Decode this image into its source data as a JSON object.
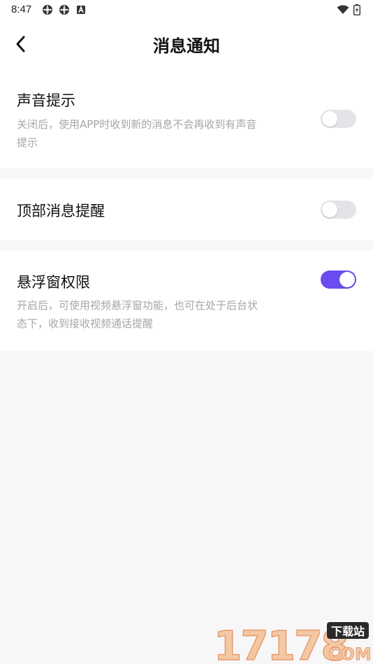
{
  "status_bar": {
    "time": "8:47",
    "left_icons": [
      "gear-notification-icon",
      "gear-notification-icon",
      "a-letter-icon"
    ],
    "right_icons": [
      "wifi-icon",
      "battery-icon"
    ]
  },
  "header": {
    "title": "消息通知",
    "back_icon": "chevron-left-icon"
  },
  "settings": [
    {
      "title": "声音提示",
      "description_line1": "关闭后，使用APP时收到新的消息不会再收到有声音",
      "description_line2": "提示",
      "enabled": false
    },
    {
      "title": "顶部消息提醒",
      "enabled": false
    },
    {
      "title": "悬浮窗权限",
      "description_line1": "开启后，可使用视频悬浮窗功能，也可在处于后台状",
      "description_line2": "态下，收到接收视频通话提醒",
      "enabled": true
    }
  ],
  "colors": {
    "accent": "#6a4cf0",
    "toggle_off": "#e4e4e8",
    "background": "#f7f7f8",
    "card": "#ffffff",
    "title_text": "#111111",
    "desc_text": "#a6a6ab"
  },
  "watermark": {
    "number": "17178",
    "tag": "下载站",
    "domain": "COM"
  }
}
